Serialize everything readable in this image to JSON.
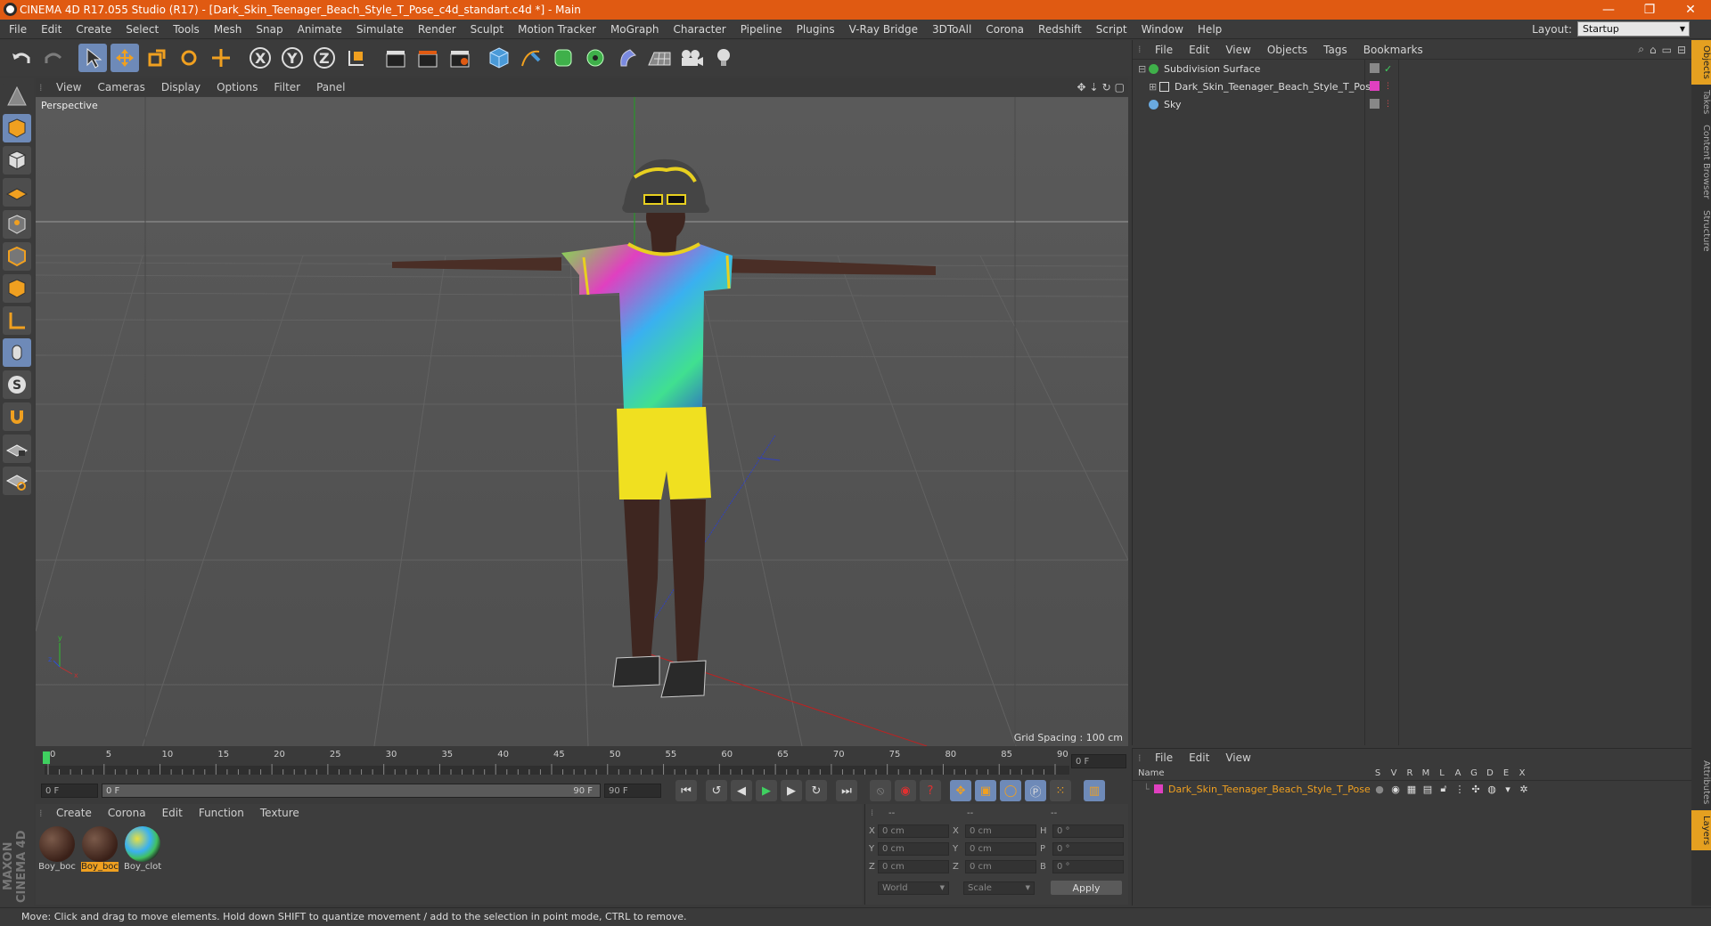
{
  "titlebar": {
    "title": "CINEMA 4D R17.055 Studio (R17) - [Dark_Skin_Teenager_Beach_Style_T_Pose_c4d_standart.c4d *] - Main",
    "minimize": "—",
    "restore": "❐",
    "close": "✕"
  },
  "menubar": {
    "items": [
      "File",
      "Edit",
      "Create",
      "Select",
      "Tools",
      "Mesh",
      "Snap",
      "Animate",
      "Simulate",
      "Render",
      "Sculpt",
      "Motion Tracker",
      "MoGraph",
      "Character",
      "Pipeline",
      "Plugins",
      "V-Ray Bridge",
      "3DToAll",
      "Corona",
      "Redshift",
      "Script",
      "Window",
      "Help"
    ],
    "layout_label": "Layout:",
    "layout_value": "Startup"
  },
  "viewport": {
    "menu": [
      "View",
      "Cameras",
      "Display",
      "Options",
      "Filter",
      "Panel"
    ],
    "label": "Perspective",
    "grid_spacing": "Grid Spacing : 100 cm"
  },
  "timeline": {
    "ticks": [
      "0",
      "5",
      "10",
      "15",
      "20",
      "25",
      "30",
      "35",
      "40",
      "45",
      "50",
      "55",
      "60",
      "65",
      "70",
      "75",
      "80",
      "85",
      "90"
    ],
    "current_frame": "0 F",
    "start_field": "0 F",
    "range_start": "0 F",
    "range_end": "90 F",
    "end_field": "90 F"
  },
  "materials": {
    "menu": [
      "Create",
      "Corona",
      "Edit",
      "Function",
      "Texture"
    ],
    "items": [
      {
        "name": "Boy_boc",
        "selected": false
      },
      {
        "name": "Boy_boc",
        "selected": true
      },
      {
        "name": "Boy_clot",
        "selected": false
      }
    ]
  },
  "coords": {
    "headers": [
      "--",
      "--",
      "--"
    ],
    "rows": [
      {
        "a": "X",
        "av": "0 cm",
        "b": "X",
        "bv": "0 cm",
        "c": "H",
        "cv": "0 °"
      },
      {
        "a": "Y",
        "av": "0 cm",
        "b": "Y",
        "bv": "0 cm",
        "c": "P",
        "cv": "0 °"
      },
      {
        "a": "Z",
        "av": "0 cm",
        "b": "Z",
        "bv": "0 cm",
        "c": "B",
        "cv": "0 °"
      }
    ],
    "mode1": "World",
    "mode2": "Scale",
    "apply": "Apply"
  },
  "status": "Move: Click and drag to move elements. Hold down SHIFT to quantize movement / add to the selection in point mode, CTRL to remove.",
  "objects": {
    "menu": [
      "File",
      "Edit",
      "View",
      "Objects",
      "Tags",
      "Bookmarks"
    ],
    "items": [
      {
        "name": "Subdivision Surface",
        "indent": 0
      },
      {
        "name": "Dark_Skin_Teenager_Beach_Style_T_Pose",
        "indent": 1
      },
      {
        "name": "Sky",
        "indent": 0
      }
    ]
  },
  "layers": {
    "menu": [
      "File",
      "Edit",
      "View"
    ],
    "col_name": "Name",
    "cols": [
      "S",
      "V",
      "R",
      "M",
      "L",
      "A",
      "G",
      "D",
      "E",
      "X"
    ],
    "row": "Dark_Skin_Teenager_Beach_Style_T_Pose"
  },
  "right_tabs": [
    "Objects",
    "Takes",
    "Content Browser",
    "Structure",
    "Attributes",
    "Layers"
  ],
  "logo": "MAXON CINEMA 4D",
  "colors": {
    "accent": "#e05a12",
    "selected": "#6e8ab8",
    "layer": "#e040c0"
  }
}
